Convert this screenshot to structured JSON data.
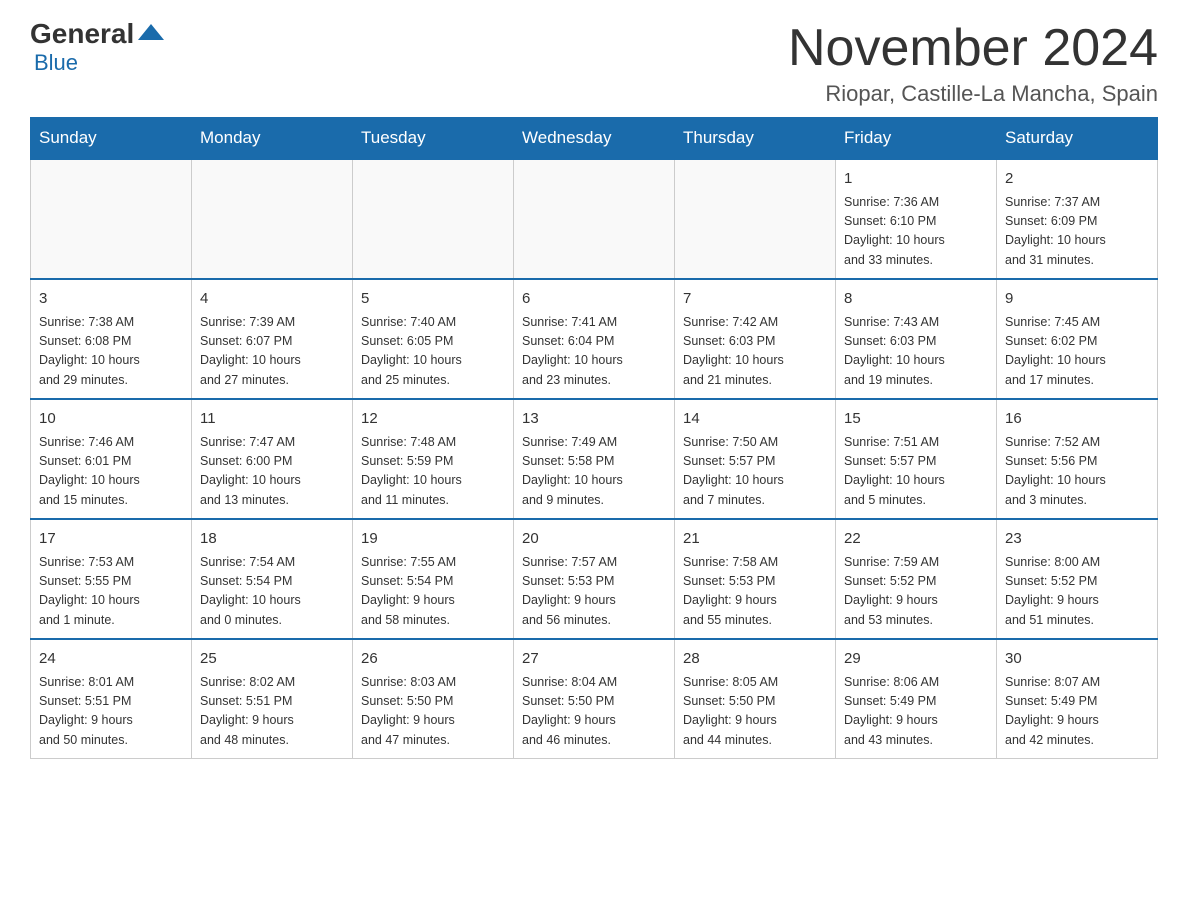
{
  "header": {
    "logo_general": "General",
    "logo_blue": "Blue",
    "month_title": "November 2024",
    "location": "Riopar, Castille-La Mancha, Spain"
  },
  "weekdays": [
    "Sunday",
    "Monday",
    "Tuesday",
    "Wednesday",
    "Thursday",
    "Friday",
    "Saturday"
  ],
  "weeks": [
    [
      {
        "day": "",
        "info": ""
      },
      {
        "day": "",
        "info": ""
      },
      {
        "day": "",
        "info": ""
      },
      {
        "day": "",
        "info": ""
      },
      {
        "day": "",
        "info": ""
      },
      {
        "day": "1",
        "info": "Sunrise: 7:36 AM\nSunset: 6:10 PM\nDaylight: 10 hours\nand 33 minutes."
      },
      {
        "day": "2",
        "info": "Sunrise: 7:37 AM\nSunset: 6:09 PM\nDaylight: 10 hours\nand 31 minutes."
      }
    ],
    [
      {
        "day": "3",
        "info": "Sunrise: 7:38 AM\nSunset: 6:08 PM\nDaylight: 10 hours\nand 29 minutes."
      },
      {
        "day": "4",
        "info": "Sunrise: 7:39 AM\nSunset: 6:07 PM\nDaylight: 10 hours\nand 27 minutes."
      },
      {
        "day": "5",
        "info": "Sunrise: 7:40 AM\nSunset: 6:05 PM\nDaylight: 10 hours\nand 25 minutes."
      },
      {
        "day": "6",
        "info": "Sunrise: 7:41 AM\nSunset: 6:04 PM\nDaylight: 10 hours\nand 23 minutes."
      },
      {
        "day": "7",
        "info": "Sunrise: 7:42 AM\nSunset: 6:03 PM\nDaylight: 10 hours\nand 21 minutes."
      },
      {
        "day": "8",
        "info": "Sunrise: 7:43 AM\nSunset: 6:03 PM\nDaylight: 10 hours\nand 19 minutes."
      },
      {
        "day": "9",
        "info": "Sunrise: 7:45 AM\nSunset: 6:02 PM\nDaylight: 10 hours\nand 17 minutes."
      }
    ],
    [
      {
        "day": "10",
        "info": "Sunrise: 7:46 AM\nSunset: 6:01 PM\nDaylight: 10 hours\nand 15 minutes."
      },
      {
        "day": "11",
        "info": "Sunrise: 7:47 AM\nSunset: 6:00 PM\nDaylight: 10 hours\nand 13 minutes."
      },
      {
        "day": "12",
        "info": "Sunrise: 7:48 AM\nSunset: 5:59 PM\nDaylight: 10 hours\nand 11 minutes."
      },
      {
        "day": "13",
        "info": "Sunrise: 7:49 AM\nSunset: 5:58 PM\nDaylight: 10 hours\nand 9 minutes."
      },
      {
        "day": "14",
        "info": "Sunrise: 7:50 AM\nSunset: 5:57 PM\nDaylight: 10 hours\nand 7 minutes."
      },
      {
        "day": "15",
        "info": "Sunrise: 7:51 AM\nSunset: 5:57 PM\nDaylight: 10 hours\nand 5 minutes."
      },
      {
        "day": "16",
        "info": "Sunrise: 7:52 AM\nSunset: 5:56 PM\nDaylight: 10 hours\nand 3 minutes."
      }
    ],
    [
      {
        "day": "17",
        "info": "Sunrise: 7:53 AM\nSunset: 5:55 PM\nDaylight: 10 hours\nand 1 minute."
      },
      {
        "day": "18",
        "info": "Sunrise: 7:54 AM\nSunset: 5:54 PM\nDaylight: 10 hours\nand 0 minutes."
      },
      {
        "day": "19",
        "info": "Sunrise: 7:55 AM\nSunset: 5:54 PM\nDaylight: 9 hours\nand 58 minutes."
      },
      {
        "day": "20",
        "info": "Sunrise: 7:57 AM\nSunset: 5:53 PM\nDaylight: 9 hours\nand 56 minutes."
      },
      {
        "day": "21",
        "info": "Sunrise: 7:58 AM\nSunset: 5:53 PM\nDaylight: 9 hours\nand 55 minutes."
      },
      {
        "day": "22",
        "info": "Sunrise: 7:59 AM\nSunset: 5:52 PM\nDaylight: 9 hours\nand 53 minutes."
      },
      {
        "day": "23",
        "info": "Sunrise: 8:00 AM\nSunset: 5:52 PM\nDaylight: 9 hours\nand 51 minutes."
      }
    ],
    [
      {
        "day": "24",
        "info": "Sunrise: 8:01 AM\nSunset: 5:51 PM\nDaylight: 9 hours\nand 50 minutes."
      },
      {
        "day": "25",
        "info": "Sunrise: 8:02 AM\nSunset: 5:51 PM\nDaylight: 9 hours\nand 48 minutes."
      },
      {
        "day": "26",
        "info": "Sunrise: 8:03 AM\nSunset: 5:50 PM\nDaylight: 9 hours\nand 47 minutes."
      },
      {
        "day": "27",
        "info": "Sunrise: 8:04 AM\nSunset: 5:50 PM\nDaylight: 9 hours\nand 46 minutes."
      },
      {
        "day": "28",
        "info": "Sunrise: 8:05 AM\nSunset: 5:50 PM\nDaylight: 9 hours\nand 44 minutes."
      },
      {
        "day": "29",
        "info": "Sunrise: 8:06 AM\nSunset: 5:49 PM\nDaylight: 9 hours\nand 43 minutes."
      },
      {
        "day": "30",
        "info": "Sunrise: 8:07 AM\nSunset: 5:49 PM\nDaylight: 9 hours\nand 42 minutes."
      }
    ]
  ]
}
